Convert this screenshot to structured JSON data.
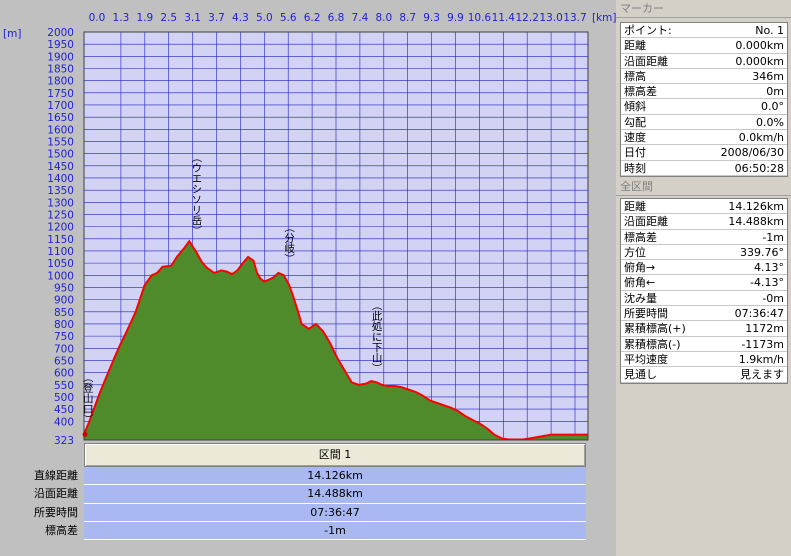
{
  "chart_data": {
    "type": "area",
    "ylabel_unit": "[m]",
    "xlabel_unit": "[km]",
    "ylim": [
      323,
      2000
    ],
    "xlim": [
      0,
      14.126
    ],
    "y_ticks": [
      2000,
      1950,
      1900,
      1850,
      1800,
      1750,
      1700,
      1650,
      1600,
      1550,
      1500,
      1450,
      1400,
      1350,
      1300,
      1250,
      1200,
      1150,
      1100,
      1050,
      1000,
      950,
      900,
      850,
      800,
      750,
      700,
      650,
      600,
      550,
      500,
      450,
      400,
      323
    ],
    "x_ticks": [
      "0.0",
      "1.3",
      "1.9",
      "2.5",
      "3.1",
      "3.7",
      "4.3",
      "5.0",
      "5.6",
      "6.2",
      "6.8",
      "7.4",
      "8.0",
      "8.7",
      "9.3",
      "9.9",
      "10.6",
      "11.4",
      "12.2",
      "13.0",
      "13.7"
    ],
    "grid": true,
    "fill_color": "#4f8a2b",
    "line_color": "#ff0000",
    "background": "#d2d2f5",
    "grid_color": "#2020c0",
    "x": [
      0.0,
      0.15,
      0.3,
      0.45,
      0.65,
      0.85,
      1.0,
      1.2,
      1.45,
      1.7,
      1.9,
      2.05,
      2.2,
      2.45,
      2.6,
      2.8,
      2.95,
      3.15,
      3.3,
      3.45,
      3.65,
      3.85,
      4.0,
      4.15,
      4.3,
      4.45,
      4.6,
      4.75,
      4.85,
      4.95,
      5.05,
      5.15,
      5.3,
      5.45,
      5.6,
      5.75,
      5.85,
      6.0,
      6.1,
      6.3,
      6.5,
      6.7,
      6.9,
      7.1,
      7.3,
      7.5,
      7.7,
      7.9,
      8.05,
      8.2,
      8.35,
      8.5,
      8.7,
      8.9,
      9.1,
      9.3,
      9.5,
      9.7,
      9.9,
      10.1,
      10.3,
      10.5,
      10.7,
      10.9,
      11.1,
      11.3,
      11.5,
      11.7,
      11.9,
      12.1,
      12.3,
      12.5,
      12.7,
      12.9,
      13.1,
      13.3,
      13.5,
      13.7,
      13.9,
      14.126
    ],
    "y": [
      346,
      400,
      460,
      520,
      590,
      660,
      710,
      770,
      850,
      960,
      1000,
      1010,
      1035,
      1040,
      1075,
      1110,
      1140,
      1095,
      1055,
      1030,
      1010,
      1020,
      1015,
      1005,
      1020,
      1050,
      1075,
      1060,
      1010,
      985,
      975,
      980,
      990,
      1010,
      1000,
      960,
      920,
      850,
      800,
      780,
      800,
      770,
      720,
      660,
      610,
      560,
      550,
      555,
      565,
      560,
      550,
      545,
      545,
      540,
      530,
      520,
      505,
      485,
      475,
      465,
      455,
      440,
      420,
      405,
      390,
      370,
      345,
      330,
      325,
      325,
      325,
      330,
      335,
      340,
      345
    ],
    "annotations": [
      {
        "label": "（ウエシソリ岳）",
        "x": 3.15
      },
      {
        "label": "（分岐）",
        "x": 5.75
      },
      {
        "label": "（此処に下山）",
        "x": 8.2
      },
      {
        "label": "（登山口）",
        "x": 0.05
      }
    ]
  },
  "section": {
    "header": "区間 1",
    "labels": [
      "直線距離",
      "沿面距離",
      "所要時間",
      "標高差"
    ],
    "values": [
      "14.126km",
      "14.488km",
      "07:36:47",
      "-1m"
    ]
  },
  "marker_panel": {
    "title": "マーカー",
    "rows": [
      {
        "label": "ポイント:",
        "value": "No. 1"
      },
      {
        "label": "距離",
        "value": "0.000km"
      },
      {
        "label": "沿面距離",
        "value": "0.000km"
      },
      {
        "label": "標高",
        "value": "346m"
      },
      {
        "label": "標高差",
        "value": "0m"
      },
      {
        "label": "傾斜",
        "value": "0.0°"
      },
      {
        "label": "勾配",
        "value": "0.0%"
      },
      {
        "label": "速度",
        "value": "0.0km/h"
      },
      {
        "label": "日付",
        "value": "2008/06/30"
      },
      {
        "label": "時刻",
        "value": "06:50:28"
      }
    ]
  },
  "all_section_panel": {
    "title": "全区間",
    "rows": [
      {
        "label": "距離",
        "value": "14.126km"
      },
      {
        "label": "沿面距離",
        "value": "14.488km"
      },
      {
        "label": "標高差",
        "value": "-1m"
      },
      {
        "label": "方位",
        "value": "339.76°"
      },
      {
        "label": "俯角→",
        "value": "4.13°"
      },
      {
        "label": "俯角←",
        "value": "-4.13°"
      },
      {
        "label": "沈み量",
        "value": "-0m"
      },
      {
        "label": "所要時間",
        "value": "07:36:47"
      },
      {
        "label": "累積標高(+)",
        "value": "1172m"
      },
      {
        "label": "累積標高(-)",
        "value": "-1173m"
      },
      {
        "label": "平均速度",
        "value": "1.9km/h"
      },
      {
        "label": "見通し",
        "value": "見えます"
      }
    ]
  }
}
